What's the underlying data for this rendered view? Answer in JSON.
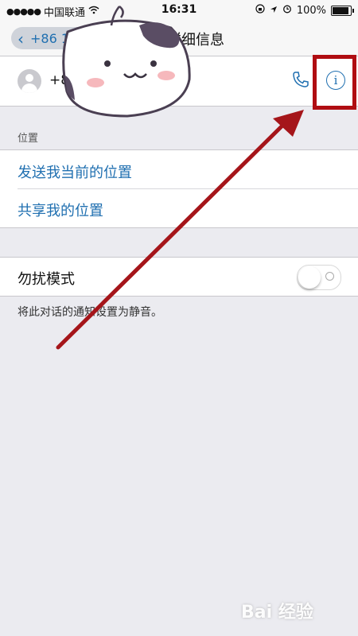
{
  "status_bar": {
    "carrier": "中国联通",
    "time": "16:31",
    "battery": "100%"
  },
  "nav": {
    "back_label": "+86 153",
    "title": "详细信息"
  },
  "contact": {
    "number": "+8"
  },
  "location": {
    "section_title": "位置",
    "send_current": "发送我当前的位置",
    "share_mine": "共享我的位置"
  },
  "dnd": {
    "label": "勿扰模式",
    "enabled": false,
    "footnote": "将此对话的通知设置为静音。"
  },
  "watermark": "Bai 经验",
  "colors": {
    "accent": "#1f6fb0",
    "annotation": "#b00d12"
  }
}
